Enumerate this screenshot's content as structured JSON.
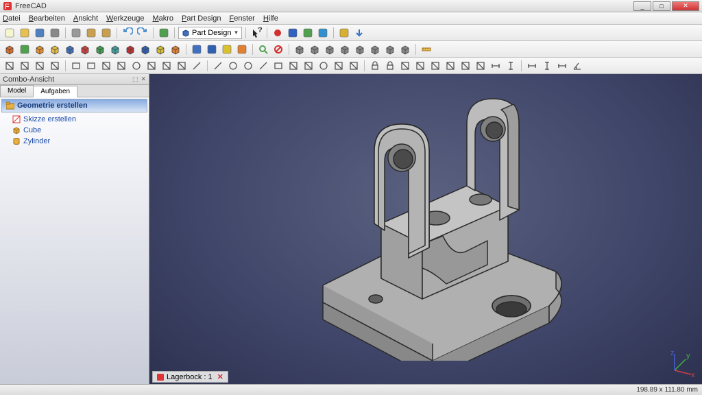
{
  "app": {
    "title": "FreeCAD"
  },
  "window_buttons": {
    "min": "_",
    "max": "□",
    "close": "✕"
  },
  "menu": {
    "items": [
      {
        "label": "Datei",
        "accel": "D"
      },
      {
        "label": "Bearbeiten",
        "accel": "B"
      },
      {
        "label": "Ansicht",
        "accel": "A"
      },
      {
        "label": "Werkzeuge",
        "accel": "W"
      },
      {
        "label": "Makro",
        "accel": "M"
      },
      {
        "label": "Part Design",
        "accel": "P"
      },
      {
        "label": "Fenster",
        "accel": "F"
      },
      {
        "label": "Hilfe",
        "accel": "H"
      }
    ]
  },
  "workbench_selector": {
    "icon": "part-design-icon",
    "label": "Part Design"
  },
  "toolbar1_icons": [
    "new-doc",
    "open-doc",
    "save-doc",
    "print",
    "sep",
    "cut",
    "copy",
    "paste",
    "sep",
    "undo",
    "redo",
    "sep",
    "refresh",
    "sep",
    "workbench",
    "sep",
    "whats-this",
    "sep",
    "record-macro",
    "stop-macro",
    "macro-list",
    "play-macro",
    "sep",
    "lock-refresh",
    "down-arrow"
  ],
  "toolbar2_icons": [
    "box-solid",
    "send",
    "cube-orange",
    "cube-layers",
    "cube-blue",
    "cube-red",
    "cube-green",
    "cube-teal",
    "cube-red2",
    "cube-blue2",
    "cube-yellow",
    "cube-orange2",
    "sep",
    "panel-grid",
    "panel-blue",
    "panel-yellow",
    "panel-orange",
    "sep",
    "zoom",
    "no-symbol",
    "sep",
    "iso-view",
    "front-view",
    "top-view",
    "right-view",
    "back-view",
    "bottom-view",
    "left-view",
    "axon-view",
    "sep",
    "measure"
  ],
  "toolbar3_icons": [
    "sketch-new",
    "sketch-edit",
    "sketch-map",
    "sketch-leave",
    "sep",
    "pad",
    "pocket",
    "revolve",
    "groove",
    "fillet",
    "chamfer",
    "draft",
    "mirror",
    "linear-pattern",
    "sep",
    "line",
    "arc",
    "circle",
    "polyline",
    "rect",
    "slot",
    "trim",
    "fillet-sk",
    "ext-geom",
    "construct",
    "sep",
    "lock-c",
    "pin-c",
    "coincident",
    "parallel",
    "perp",
    "tangent",
    "equal",
    "symm",
    "horiz",
    "vert",
    "sep",
    "dist-h",
    "dist-v",
    "length",
    "angle"
  ],
  "combo_panel": {
    "title": "Combo-Ansicht",
    "tabs": [
      {
        "label": "Model",
        "active": false
      },
      {
        "label": "Aufgaben",
        "active": true
      }
    ],
    "task_header": "Geometrie erstellen",
    "task_items": [
      {
        "icon": "sketch-icon",
        "label": "Skizze erstellen"
      },
      {
        "icon": "cube-icon",
        "label": "Cube"
      },
      {
        "icon": "cylinder-icon",
        "label": "Zylinder"
      }
    ]
  },
  "document_tabs": {
    "name": "Lagerbock : 1",
    "close_icon": "✕"
  },
  "statusbar": {
    "dimensions": "198.89 x 111.80 mm"
  },
  "axis_labels": {
    "x": "x",
    "y": "y",
    "z": "z"
  },
  "colors": {
    "axis_x": "#d04040",
    "axis_y": "#40b040",
    "axis_z": "#4060d0",
    "part_fill": "#b8b8b8",
    "part_edge": "#2a2a2a"
  }
}
